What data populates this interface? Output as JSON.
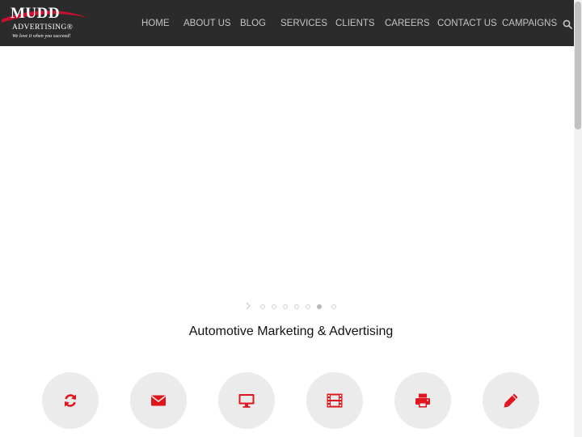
{
  "brand": {
    "name": "MUDD",
    "sub": "ADVERTISING®",
    "tagline": "We love it when you succeed!",
    "accent_color": "#c8102e"
  },
  "nav": {
    "items": [
      {
        "label": "HOME"
      },
      {
        "label": "ABOUT US"
      },
      {
        "label": "BLOG"
      },
      {
        "label": "SERVICES"
      },
      {
        "label": "CLIENTS"
      },
      {
        "label": "CAREERS"
      },
      {
        "label": "CONTACT US"
      },
      {
        "label": "CAMPAIGNS"
      }
    ],
    "search_icon": "search-icon"
  },
  "slider": {
    "dot_count": 7,
    "active_dot": 6
  },
  "section": {
    "title": "Automotive Marketing & Advertising"
  },
  "services": [
    {
      "icon": "refresh-icon"
    },
    {
      "icon": "envelope-icon"
    },
    {
      "icon": "desktop-icon"
    },
    {
      "icon": "film-icon"
    },
    {
      "icon": "print-icon"
    },
    {
      "icon": "pencil-icon"
    }
  ],
  "colors": {
    "header_bg": "#2b2b2b",
    "icon_red": "#e0161f",
    "circle_bg": "#ebebeb"
  }
}
